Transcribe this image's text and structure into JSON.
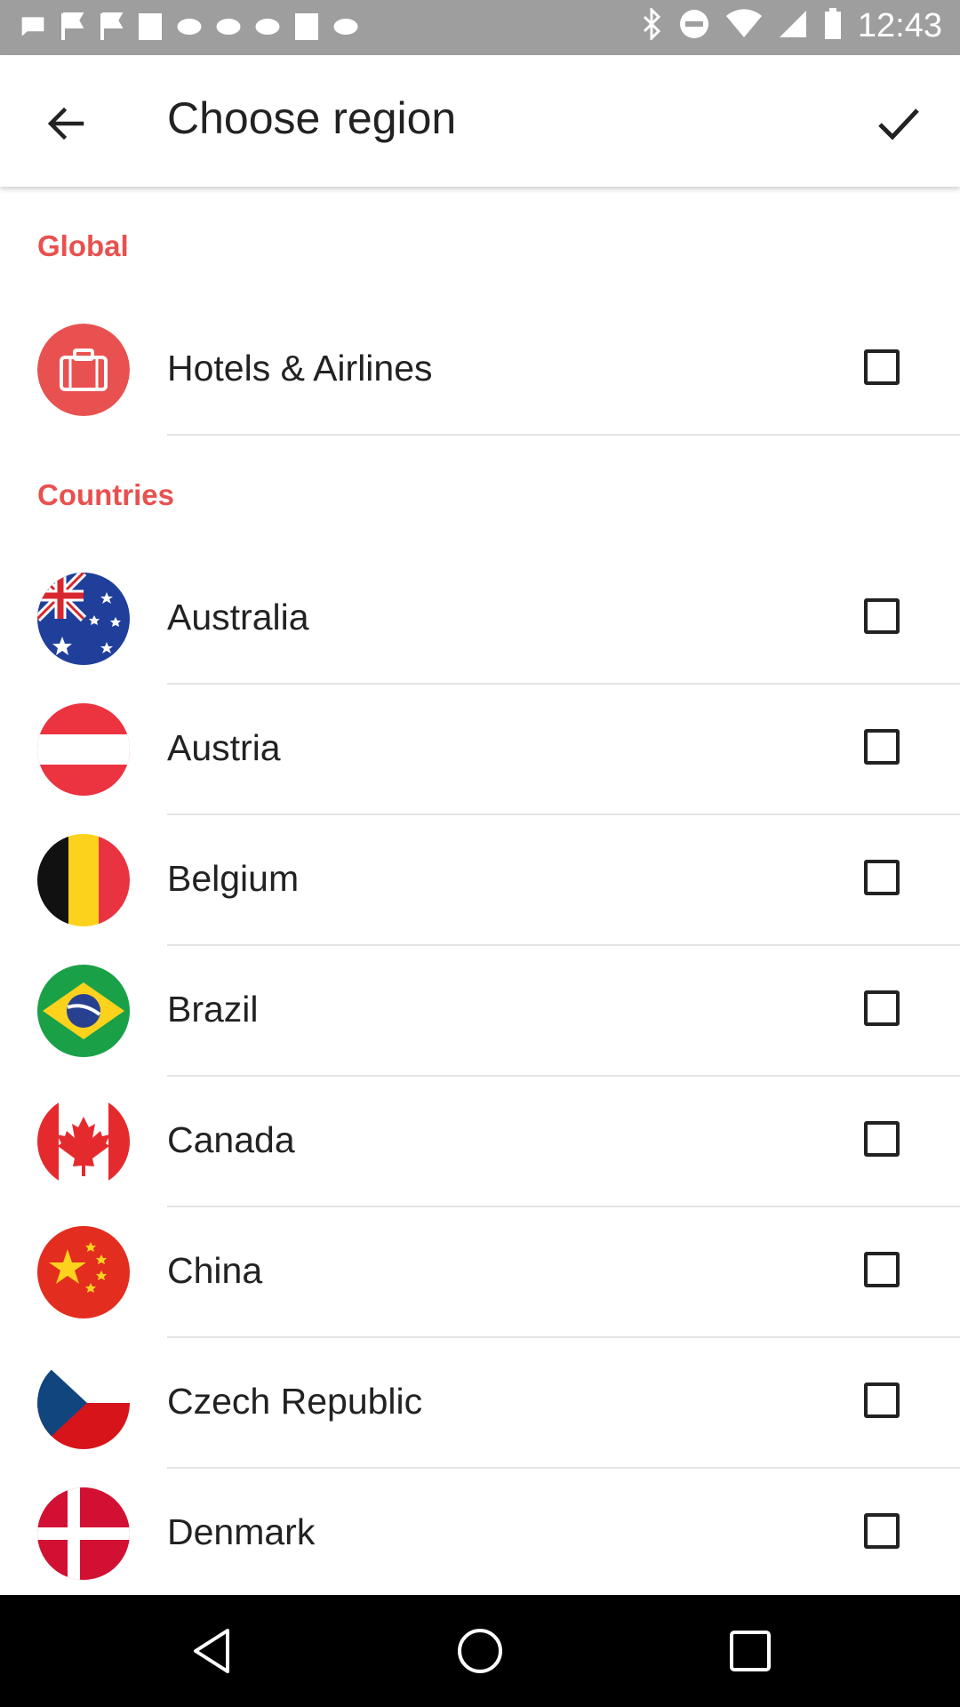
{
  "status_bar": {
    "time": "12:43"
  },
  "app_bar": {
    "title": "Choose region"
  },
  "sections": {
    "global_label": "Global",
    "countries_label": "Countries"
  },
  "global_items": [
    {
      "label": "Hotels & Airlines",
      "icon": "briefcase-icon",
      "checked": false
    }
  ],
  "countries": [
    {
      "label": "Australia",
      "icon": "australia-flag-icon",
      "checked": false
    },
    {
      "label": "Austria",
      "icon": "austria-flag-icon",
      "checked": false
    },
    {
      "label": "Belgium",
      "icon": "belgium-flag-icon",
      "checked": false
    },
    {
      "label": "Brazil",
      "icon": "brazil-flag-icon",
      "checked": false
    },
    {
      "label": "Canada",
      "icon": "canada-flag-icon",
      "checked": false
    },
    {
      "label": "China",
      "icon": "china-flag-icon",
      "checked": false
    },
    {
      "label": "Czech Republic",
      "icon": "czech-republic-flag-icon",
      "checked": false
    },
    {
      "label": "Denmark",
      "icon": "denmark-flag-icon",
      "checked": false
    }
  ],
  "colors": {
    "accent": "#e8514f",
    "status_bar": "#9e9e9e",
    "nav_bar": "#000000"
  }
}
